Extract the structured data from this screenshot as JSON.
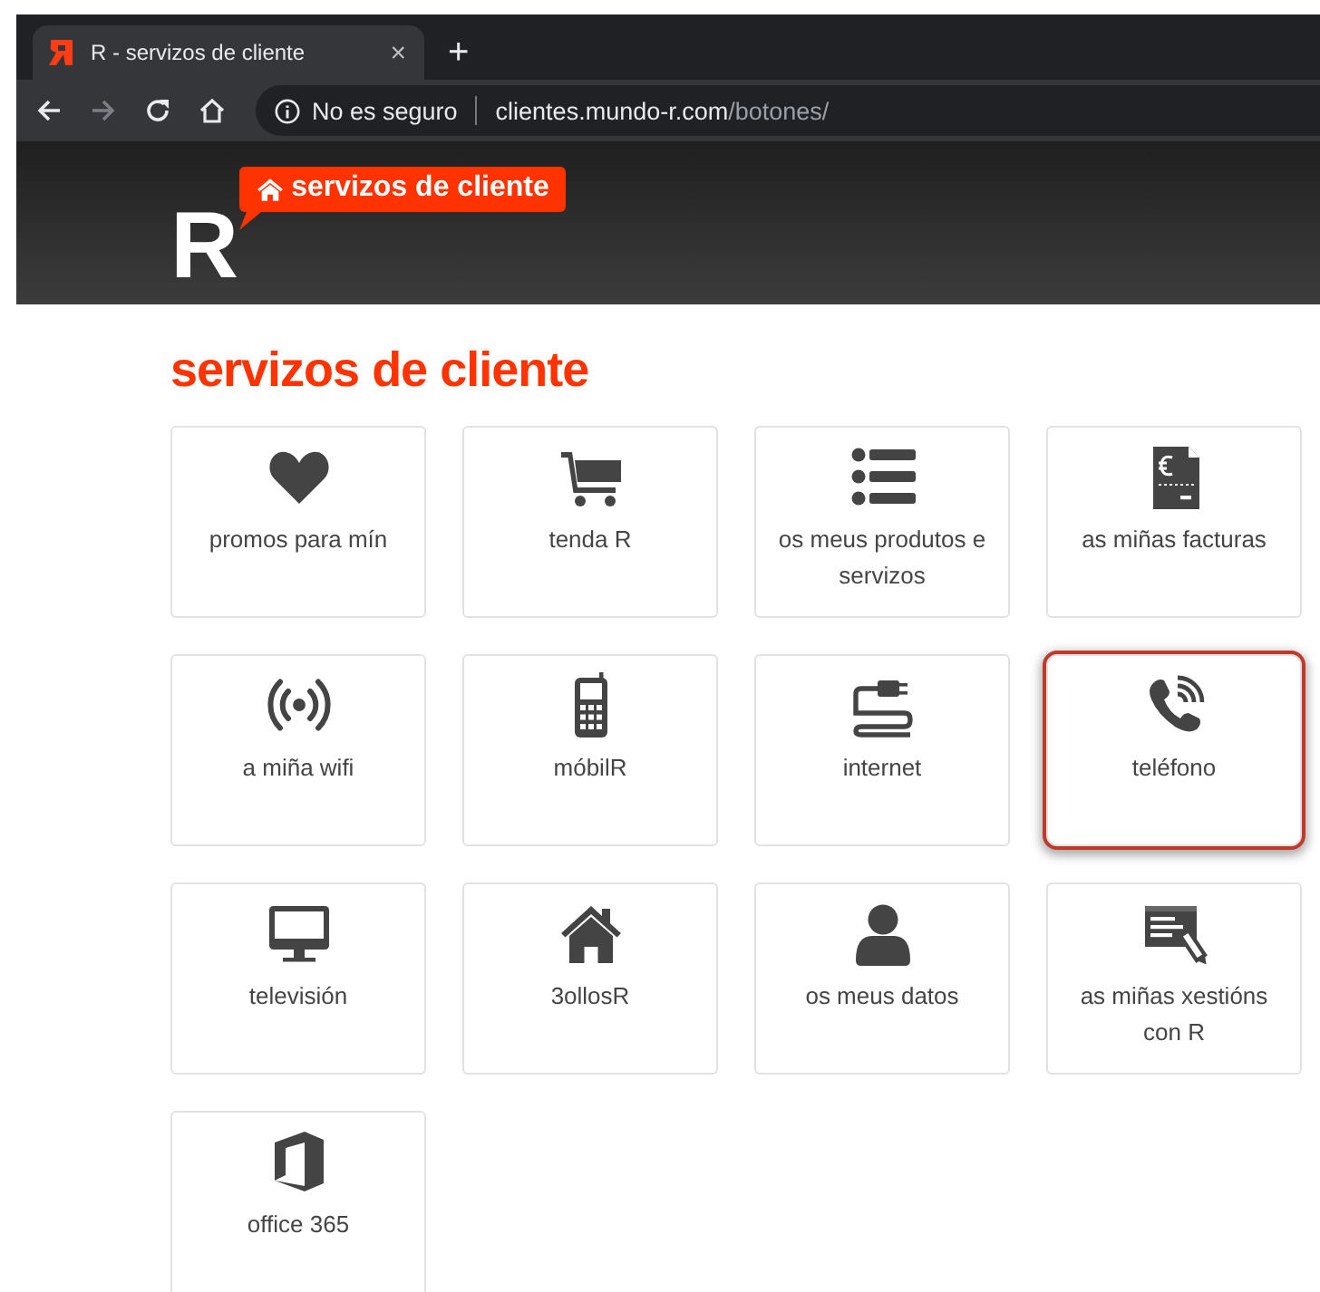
{
  "browser": {
    "tab": {
      "title": "R - servizos de cliente",
      "selected": true
    },
    "new_tab": "+",
    "close": "×",
    "security": "No es seguro",
    "url": {
      "host": "clientes.mundo-r.com",
      "path": "/botones/"
    }
  },
  "header": {
    "logo": "R",
    "badge": "servizos de cliente"
  },
  "page_title": "servizos de cliente",
  "tiles": [
    {
      "kind": "heart",
      "label": "promos para mín",
      "selected": false
    },
    {
      "kind": "cart",
      "label": "tenda R",
      "selected": false
    },
    {
      "kind": "list",
      "label": "os meus produtos e servizos",
      "selected": false
    },
    {
      "kind": "invoice",
      "label": "as miñas facturas",
      "selected": false
    },
    {
      "kind": "wifi",
      "label": "a miña wifi",
      "selected": false
    },
    {
      "kind": "mobile",
      "label": "móbilR",
      "selected": false
    },
    {
      "kind": "internet",
      "label": "internet",
      "selected": false
    },
    {
      "kind": "phone",
      "label": "teléfono",
      "selected": true
    },
    {
      "kind": "tv",
      "label": "televisión",
      "selected": false
    },
    {
      "kind": "house",
      "label": "3ollosR",
      "selected": false
    },
    {
      "kind": "user",
      "label": "os meus datos",
      "selected": false
    },
    {
      "kind": "edit",
      "label": "as miñas xestións con R",
      "selected": false
    },
    {
      "kind": "office",
      "label": "office 365",
      "selected": false
    }
  ]
}
